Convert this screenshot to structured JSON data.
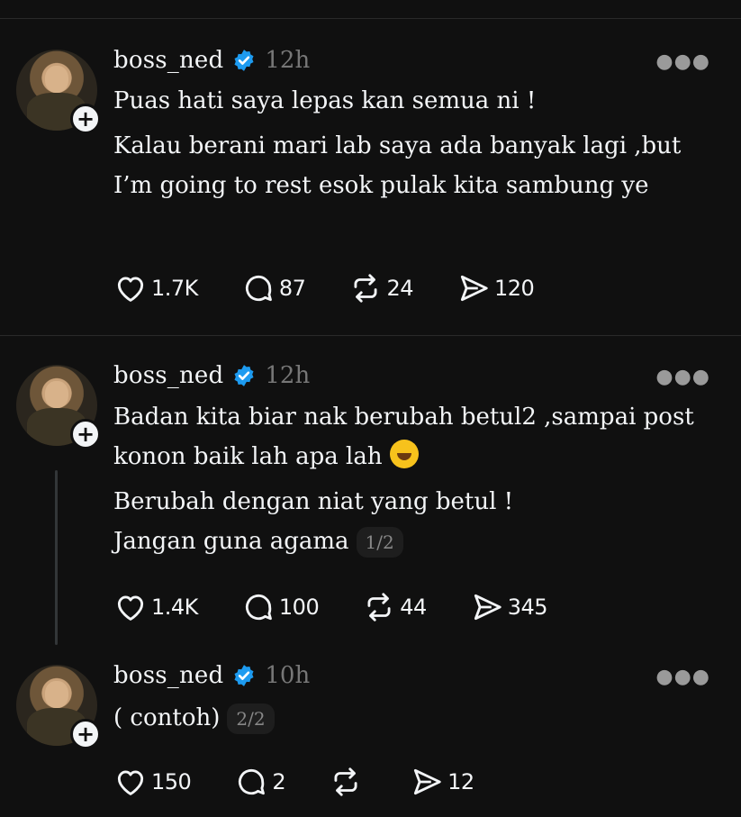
{
  "posts": [
    {
      "username": "boss_ned",
      "time": "12h",
      "paragraphs": [
        "Puas hati saya lepas kan semua ni !",
        "Kalau berani mari lab saya ada banyak lagi ,but I’m going to rest esok pulak kita sambung ye"
      ],
      "likes": "1.7K",
      "replies": "87",
      "reposts": "24",
      "shares": "120"
    },
    {
      "username": "boss_ned",
      "time": "12h",
      "paragraphs": [
        "Badan kita biar nak berubah betul2 ,sampai post konon baik lah apa lah",
        "Berubah dengan niat yang betul !",
        "Jangan guna agama"
      ],
      "thread_counter": "1/2",
      "likes": "1.4K",
      "replies": "100",
      "reposts": "44",
      "shares": "345"
    },
    {
      "username": "boss_ned",
      "time": "10h",
      "paragraphs": [
        "( contoh)"
      ],
      "thread_counter": "2/2",
      "likes": "150",
      "replies": "2",
      "reposts": "",
      "shares": "12"
    }
  ],
  "icons": {
    "verified": "verified-badge-icon",
    "like": "heart-icon",
    "reply": "comment-icon",
    "repost": "repost-icon",
    "share": "share-icon",
    "more": "more-options-icon"
  },
  "colors": {
    "background": "#101010",
    "verified": "#1d9bf0",
    "muted": "#777777"
  }
}
